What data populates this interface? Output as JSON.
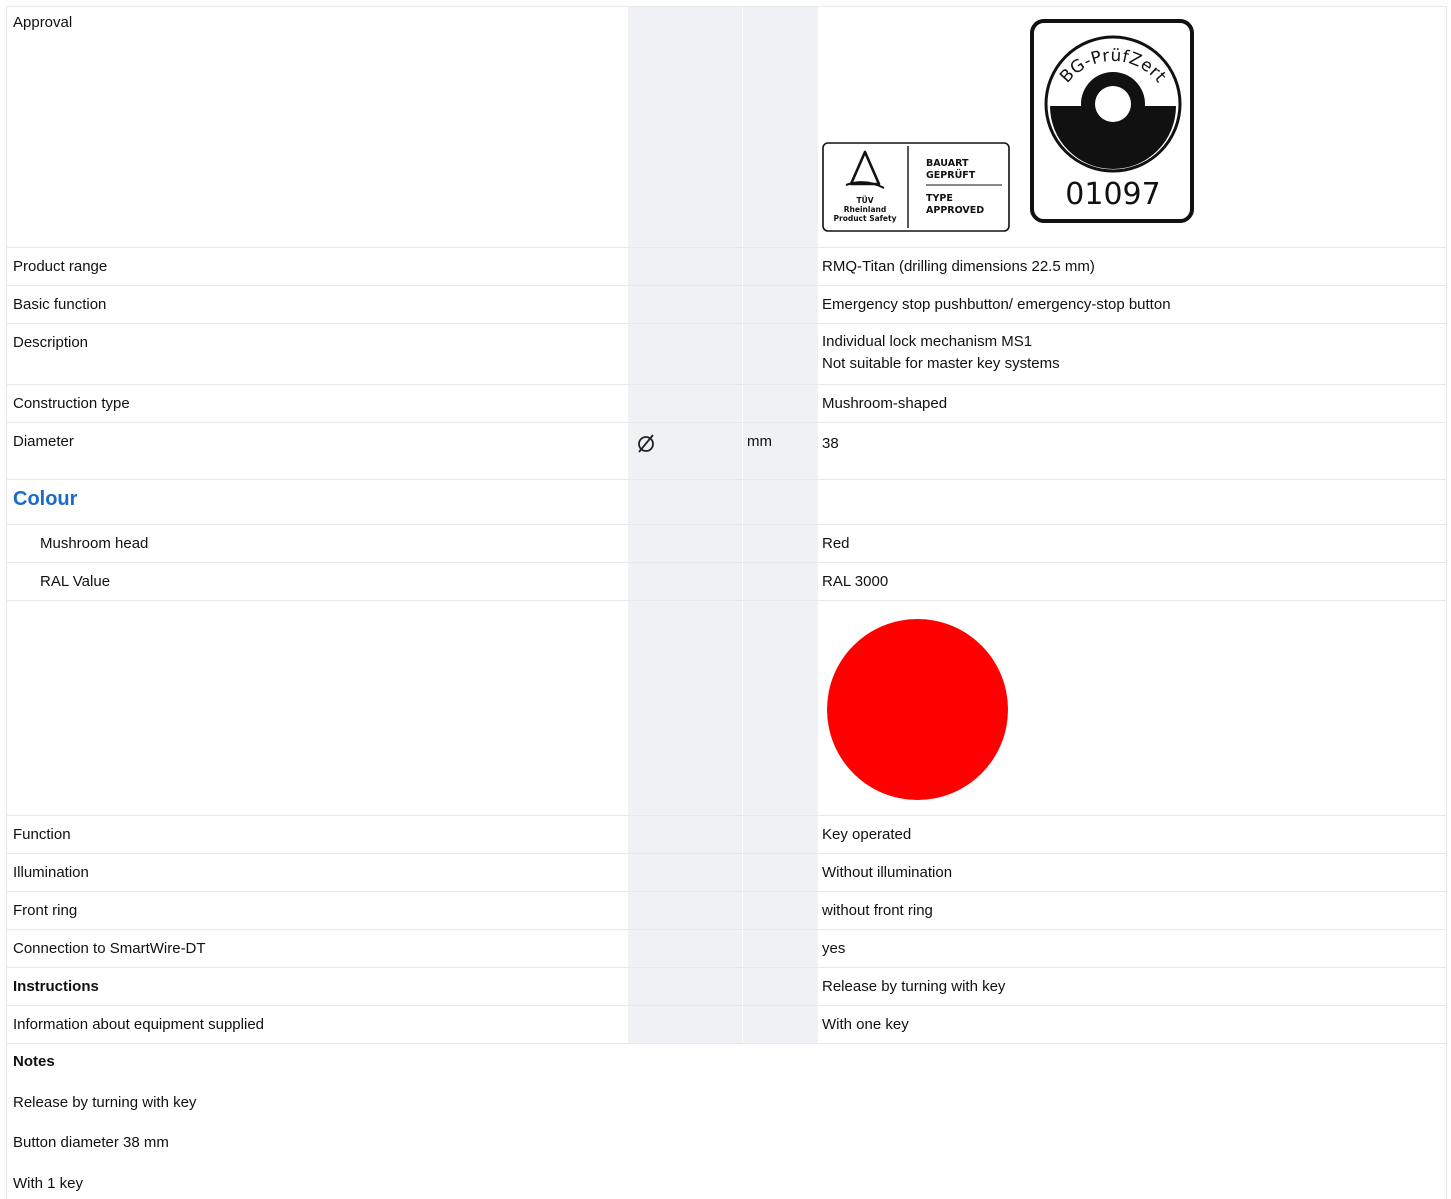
{
  "approval": {
    "label": "Approval",
    "tuv_badge": {
      "org_line1": "TÜV",
      "org_line2": "Rheinland",
      "org_line3": "Product Safety",
      "text1": "BAUART",
      "text2": "GEPRÜFT",
      "text3": "TYPE",
      "text4": "APPROVED"
    },
    "bg_badge": {
      "arc_text": "BG-PrüfZert",
      "number": "01097"
    }
  },
  "rows": {
    "product_range": {
      "label": "Product range",
      "value": "RMQ-Titan (drilling dimensions 22.5 mm)"
    },
    "basic_function": {
      "label": "Basic function",
      "value": "Emergency stop pushbutton/ emergency-stop button"
    },
    "description": {
      "label": "Description",
      "value_line1": "Individual lock mechanism MS1",
      "value_line2": "Not suitable for master key systems"
    },
    "construction_type": {
      "label": "Construction type",
      "value": "Mushroom-shaped"
    },
    "diameter": {
      "label": "Diameter",
      "symbol_icon": "diameter-symbol-icon",
      "unit": "mm",
      "value": "38"
    }
  },
  "colour": {
    "title": "Colour",
    "mushroom_head": {
      "label": "Mushroom head",
      "value": "Red"
    },
    "ral_value": {
      "label": "RAL Value",
      "value": "RAL 3000"
    },
    "swatch_color": "#ff0000"
  },
  "rows2": {
    "function": {
      "label": "Function",
      "value": "Key operated"
    },
    "illumination": {
      "label": "Illumination",
      "value": "Without illumination"
    },
    "front_ring": {
      "label": "Front ring",
      "value": "without front ring"
    },
    "smartwire": {
      "label": "Connection to SmartWire-DT",
      "value": "yes"
    },
    "instructions": {
      "label": "Instructions",
      "value": "Release by turning with key"
    },
    "equipment": {
      "label": "Information about equipment supplied",
      "value": "With one key"
    }
  },
  "notes": {
    "title": "Notes",
    "items": [
      "Release by turning with key",
      "Button diameter 38 mm",
      "With 1 key"
    ]
  }
}
